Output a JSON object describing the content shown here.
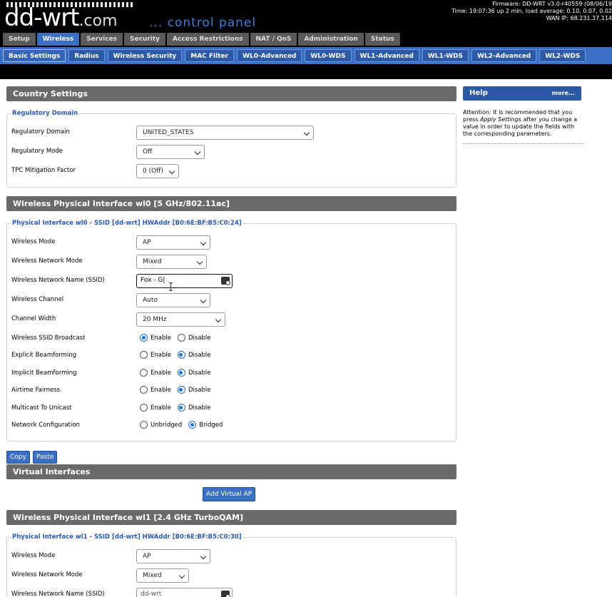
{
  "header": {
    "logo": "dd-wrt",
    "logo_suffix": ".com",
    "control_panel": "... control panel",
    "firmware": "Firmware: DD-WRT v3.0-r40559 (08/06/19",
    "time": "Time: 19:07:36 up 2 min, load average: 0.10, 0.07, 0.02",
    "wan_ip": "WAN IP: 68.231.37.114"
  },
  "main_tabs": [
    "Setup",
    "Wireless",
    "Services",
    "Security",
    "Access Restrictions",
    "NAT / QoS",
    "Administration",
    "Status"
  ],
  "sub_tabs": [
    "Basic Settings",
    "Radius",
    "Wireless Security",
    "MAC Filter",
    "WL0-Advanced",
    "WL0-WDS",
    "WL1-Advanced",
    "WL1-WDS",
    "WL2-Advanced",
    "WL2-WDS"
  ],
  "country": {
    "title": "Country Settings",
    "legend": "Regulatory Domain",
    "rows": [
      {
        "label": "Regulatory Domain",
        "value": "UNITED_STATES"
      },
      {
        "label": "Regulatory Mode",
        "value": "Off"
      },
      {
        "label": "TPC Mitigation Factor",
        "value": "0 (Off)"
      }
    ]
  },
  "wl0": {
    "title": "Wireless Physical Interface wl0 [5 GHz/802.11ac]",
    "legend": "Physical Interface wl0 - SSID [dd-wrt] HWAddr [B0:6E:BF:B5:C0:24]",
    "mode_label": "Wireless Mode",
    "mode": "AP",
    "netmode_label": "Wireless Network Mode",
    "netmode": "Mixed",
    "ssid_label": "Wireless Network Name (SSID)",
    "ssid": "Fox - G",
    "channel_label": "Wireless Channel",
    "channel": "Auto",
    "width_label": "Channel Width",
    "width": "20 MHz",
    "broadcast_label": "Wireless SSID Broadcast",
    "explicit_label": "Explicit Beamforming",
    "implicit_label": "Implicit Beamforming",
    "airtime_label": "Airtime Fairness",
    "multicast_label": "Multicast To Unicast",
    "netconf_label": "Network Configuration",
    "enable": "Enable",
    "disable": "Disable",
    "unbridged": "Unbridged",
    "bridged": "Bridged"
  },
  "buttons": {
    "copy": "Copy",
    "paste": "Paste",
    "add_virtual_ap": "Add Virtual AP"
  },
  "virtual": {
    "title": "Virtual Interfaces"
  },
  "wl1": {
    "title": "Wireless Physical Interface wl1 [2.4 GHz TurboQAM]",
    "legend": "Physical Interface wl1 - SSID [dd-wrt] HWAddr [B0:6E:BF:B5:C0:30]",
    "mode_label": "Wireless Mode",
    "mode": "AP",
    "netmode_label": "Wireless Network Mode",
    "netmode": "Mixed",
    "ssid_label": "Wireless Network Name (SSID)",
    "ssid": "dd-wrt"
  },
  "help": {
    "title": "Help",
    "more": "more...",
    "text_pre": "Attention: It is recommended that you press",
    "text_em": "Apply Settings",
    "text_post": "after you change a value in order to update the fields with the corresponding parameters."
  }
}
